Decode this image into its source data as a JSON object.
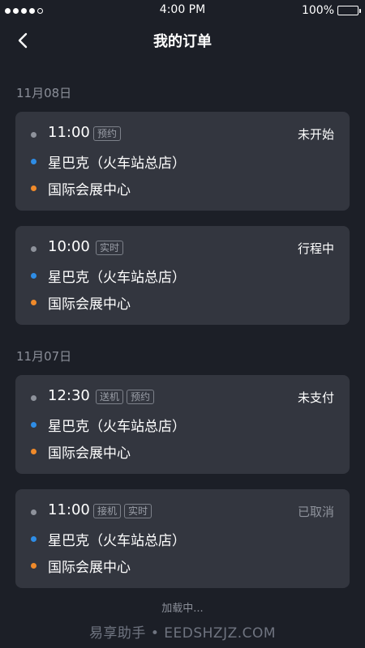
{
  "status_bar": {
    "time": "4:00 PM",
    "battery": "100%",
    "battery_level": 1.0,
    "signal_bars_filled": 4,
    "signal_bars_total": 5
  },
  "nav": {
    "title": "我的订单",
    "back_icon": "chevron-left-icon"
  },
  "groups": [
    {
      "date": "11月08日",
      "orders": [
        {
          "time": "11:00",
          "tags": [
            "预约"
          ],
          "status": "未开始",
          "status_style": "active",
          "from": "星巴克（火车站总店）",
          "to": "国际会展中心"
        },
        {
          "time": "10:00",
          "tags": [
            "实时"
          ],
          "status": "行程中",
          "status_style": "active",
          "from": "星巴克（火车站总店）",
          "to": "国际会展中心"
        }
      ]
    },
    {
      "date": "11月07日",
      "orders": [
        {
          "time": "12:30",
          "tags": [
            "送机",
            "预约"
          ],
          "status": "未支付",
          "status_style": "active",
          "from": "星巴克（火车站总店）",
          "to": "国际会展中心"
        },
        {
          "time": "11:00",
          "tags": [
            "接机",
            "实时"
          ],
          "status": "已取消",
          "status_style": "muted",
          "from": "星巴克（火车站总店）",
          "to": "国际会展中心"
        }
      ]
    }
  ],
  "loading_text": "加载中...",
  "watermark": "易享助手 • EEDSHZJZ.COM",
  "colors": {
    "background": "#1c1f27",
    "card": "#33363f",
    "from_dot": "#2e8de6",
    "to_dot": "#f08a2a",
    "time_dot": "#8e929b"
  }
}
